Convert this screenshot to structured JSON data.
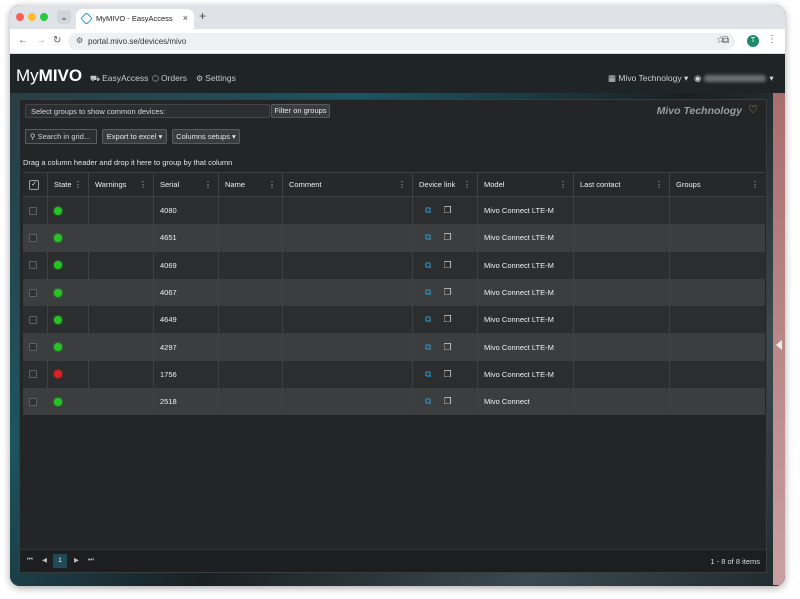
{
  "browser": {
    "tab_title": "MyMIVO - EasyAccess",
    "tab_close": "×",
    "new_tab": "+",
    "tab_menu": "⌄",
    "url": "portal.mivo.se/devices/mivo",
    "profile_initial": "T"
  },
  "app": {
    "logo_prefix": "My",
    "logo_bold": "MIVO",
    "nav": [
      {
        "label": "EasyAccess",
        "icon": "car-icon"
      },
      {
        "label": "Orders",
        "icon": "package-icon"
      },
      {
        "label": "Settings",
        "icon": "gear-icon"
      }
    ],
    "company_menu": "Mivo Technology"
  },
  "toolbar": {
    "group_placeholder": "Select groups to show common devices:",
    "filter_button": "Filter on groups",
    "brand_title": "Mivo Technology",
    "search_placeholder": "Search in grid...",
    "export_button": "Export to excel",
    "columns_button": "Columns setups",
    "group_hint": "Drag a column header and drop it here to group by that column"
  },
  "grid": {
    "columns": [
      "State",
      "Warnings",
      "Serial",
      "Name",
      "Comment",
      "Device link",
      "Model",
      "Last contact",
      "Groups"
    ],
    "rows": [
      {
        "state": "green",
        "serial": "4080",
        "model": "Mivo Connect LTE-M"
      },
      {
        "state": "green",
        "serial": "4651",
        "model": "Mivo Connect LTE-M"
      },
      {
        "state": "green",
        "serial": "4069",
        "model": "Mivo Connect LTE-M"
      },
      {
        "state": "green",
        "serial": "4067",
        "model": "Mivo Connect LTE-M"
      },
      {
        "state": "green",
        "serial": "4649",
        "model": "Mivo Connect LTE-M"
      },
      {
        "state": "green",
        "serial": "4297",
        "model": "Mivo Connect LTE-M"
      },
      {
        "state": "red",
        "serial": "1756",
        "model": "Mivo Connect LTE-M"
      },
      {
        "state": "green",
        "serial": "2518",
        "model": "Mivo Connect"
      }
    ]
  },
  "pager": {
    "first": "⏮",
    "prev": "◀",
    "current_page": "1",
    "next": "▶",
    "last": "⏭",
    "info": "1 - 8 of 8 items"
  },
  "colors": {
    "state_green": "#26c226",
    "state_red": "#e02020",
    "accent": "#2b9fd9",
    "brand_heart": "#d4b038"
  }
}
